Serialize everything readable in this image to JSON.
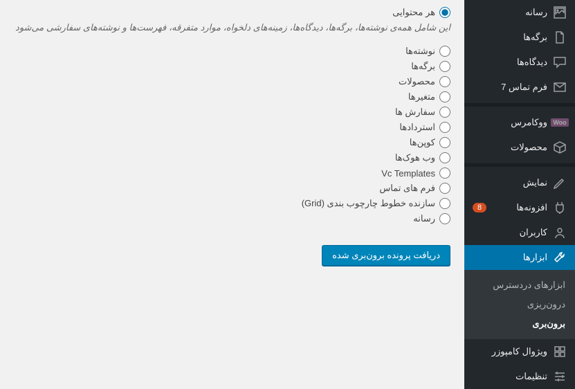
{
  "sidebar": {
    "items": [
      {
        "label": "رسانه",
        "icon": "media"
      },
      {
        "label": "برگه‌ها",
        "icon": "pages"
      },
      {
        "label": "دیدگاه‌ها",
        "icon": "comments"
      },
      {
        "label": "فرم تماس 7",
        "icon": "contact"
      },
      {
        "label": "ووکامرس",
        "icon": "woo"
      },
      {
        "label": "محصولات",
        "icon": "products"
      },
      {
        "label": "نمایش",
        "icon": "appearance"
      },
      {
        "label": "افزونه‌ها",
        "icon": "plugins",
        "badge": "8"
      },
      {
        "label": "کاربران",
        "icon": "users"
      },
      {
        "label": "ابزارها",
        "icon": "tools",
        "current": true
      },
      {
        "label": "ویژوال کامپوزر",
        "icon": "vc"
      },
      {
        "label": "تنظیمات",
        "icon": "settings"
      }
    ],
    "submenu": [
      {
        "label": "ابزارهای دردسترس"
      },
      {
        "label": "درون‌ریزی"
      },
      {
        "label": "برون‌بری",
        "current": true
      }
    ]
  },
  "form": {
    "options": [
      {
        "label": "هر محتوایی",
        "checked": true,
        "desc": "این شامل همه‌ی نوشته‌ها، برگه‌ها، دیدگاه‌ها، زمینه‌های دلخواه، موارد متفرقه، فهرست‌ها و نوشته‌های سفارشی می‌شود"
      },
      {
        "label": "نوشته‌ها"
      },
      {
        "label": "برگه‌ها"
      },
      {
        "label": "محصولات"
      },
      {
        "label": "متغیرها"
      },
      {
        "label": "سفارش ها"
      },
      {
        "label": "استردادها"
      },
      {
        "label": "کوپن‌ها"
      },
      {
        "label": "وب هوک‌ها"
      },
      {
        "label": "Vc Templates"
      },
      {
        "label": "فرم های تماس"
      },
      {
        "label": "سازنده خطوط چارچوب بندی (Grid)"
      },
      {
        "label": "رسانه"
      }
    ],
    "submit": "دریافت پرونده برون‌بری شده"
  }
}
